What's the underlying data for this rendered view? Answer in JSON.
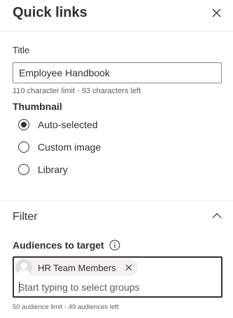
{
  "panel": {
    "title": "Quick links",
    "close_icon": "close-icon"
  },
  "title_field": {
    "label": "Title",
    "value": "Employee Handbook",
    "hint": "110 character limit - 93 characters left"
  },
  "thumbnail": {
    "label": "Thumbnail",
    "options": [
      {
        "label": "Auto-selected",
        "checked": true
      },
      {
        "label": "Custom image",
        "checked": false
      },
      {
        "label": "Library",
        "checked": false
      }
    ]
  },
  "filter": {
    "title": "Filter",
    "expanded": true,
    "chevron_icon": "chevron-up-icon"
  },
  "audiences": {
    "label": "Audiences to target",
    "info_icon": "info-icon",
    "selected": [
      {
        "label": "HR Team Members",
        "avatar_icon": "person-avatar-icon"
      }
    ],
    "placeholder": "Start typing to select groups",
    "hint": "50 audience limit - 49 audiences left"
  },
  "colors": {
    "text": "#323130",
    "secondary_text": "#605e5c",
    "divider": "#edebe9",
    "chip_bg": "#f3f2f1"
  }
}
